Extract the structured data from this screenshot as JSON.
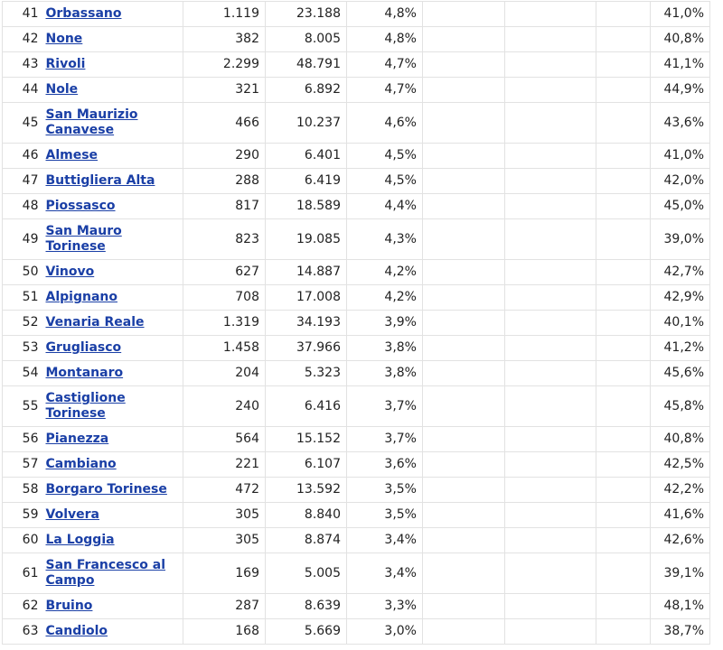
{
  "rows": [
    {
      "rank": "41",
      "name": "Orbassano",
      "count": "1.119",
      "population": "23.188",
      "percent": "4,8%",
      "last": "41,0%",
      "two_line": false
    },
    {
      "rank": "42",
      "name": "None",
      "count": "382",
      "population": "8.005",
      "percent": "4,8%",
      "last": "40,8%",
      "two_line": false
    },
    {
      "rank": "43",
      "name": "Rivoli",
      "count": "2.299",
      "population": "48.791",
      "percent": "4,7%",
      "last": "41,1%",
      "two_line": false
    },
    {
      "rank": "44",
      "name": "Nole",
      "count": "321",
      "population": "6.892",
      "percent": "4,7%",
      "last": "44,9%",
      "two_line": false
    },
    {
      "rank": "45",
      "name": "San Maurizio Canavese",
      "count": "466",
      "population": "10.237",
      "percent": "4,6%",
      "last": "43,6%",
      "two_line": true
    },
    {
      "rank": "46",
      "name": "Almese",
      "count": "290",
      "population": "6.401",
      "percent": "4,5%",
      "last": "41,0%",
      "two_line": false
    },
    {
      "rank": "47",
      "name": "Buttigliera Alta",
      "count": "288",
      "population": "6.419",
      "percent": "4,5%",
      "last": "42,0%",
      "two_line": false
    },
    {
      "rank": "48",
      "name": "Piossasco",
      "count": "817",
      "population": "18.589",
      "percent": "4,4%",
      "last": "45,0%",
      "two_line": false
    },
    {
      "rank": "49",
      "name": "San Mauro Torinese",
      "count": "823",
      "population": "19.085",
      "percent": "4,3%",
      "last": "39,0%",
      "two_line": true
    },
    {
      "rank": "50",
      "name": "Vinovo",
      "count": "627",
      "population": "14.887",
      "percent": "4,2%",
      "last": "42,7%",
      "two_line": false
    },
    {
      "rank": "51",
      "name": "Alpignano",
      "count": "708",
      "population": "17.008",
      "percent": "4,2%",
      "last": "42,9%",
      "two_line": false
    },
    {
      "rank": "52",
      "name": "Venaria Reale",
      "count": "1.319",
      "population": "34.193",
      "percent": "3,9%",
      "last": "40,1%",
      "two_line": false
    },
    {
      "rank": "53",
      "name": "Grugliasco",
      "count": "1.458",
      "population": "37.966",
      "percent": "3,8%",
      "last": "41,2%",
      "two_line": false
    },
    {
      "rank": "54",
      "name": "Montanaro",
      "count": "204",
      "population": "5.323",
      "percent": "3,8%",
      "last": "45,6%",
      "two_line": false
    },
    {
      "rank": "55",
      "name": "Castiglione Torinese",
      "count": "240",
      "population": "6.416",
      "percent": "3,7%",
      "last": "45,8%",
      "two_line": true
    },
    {
      "rank": "56",
      "name": "Pianezza",
      "count": "564",
      "population": "15.152",
      "percent": "3,7%",
      "last": "40,8%",
      "two_line": false
    },
    {
      "rank": "57",
      "name": "Cambiano",
      "count": "221",
      "population": "6.107",
      "percent": "3,6%",
      "last": "42,5%",
      "two_line": false
    },
    {
      "rank": "58",
      "name": "Borgaro Torinese",
      "count": "472",
      "population": "13.592",
      "percent": "3,5%",
      "last": "42,2%",
      "two_line": false
    },
    {
      "rank": "59",
      "name": "Volvera",
      "count": "305",
      "population": "8.840",
      "percent": "3,5%",
      "last": "41,6%",
      "two_line": false
    },
    {
      "rank": "60",
      "name": "La Loggia",
      "count": "305",
      "population": "8.874",
      "percent": "3,4%",
      "last": "42,6%",
      "two_line": false
    },
    {
      "rank": "61",
      "name": "San Francesco al Campo",
      "count": "169",
      "population": "5.005",
      "percent": "3,4%",
      "last": "39,1%",
      "two_line": true
    },
    {
      "rank": "62",
      "name": "Bruino",
      "count": "287",
      "population": "8.639",
      "percent": "3,3%",
      "last": "48,1%",
      "two_line": false
    },
    {
      "rank": "63",
      "name": "Candiolo",
      "count": "168",
      "population": "5.669",
      "percent": "3,0%",
      "last": "38,7%",
      "two_line": false
    }
  ]
}
